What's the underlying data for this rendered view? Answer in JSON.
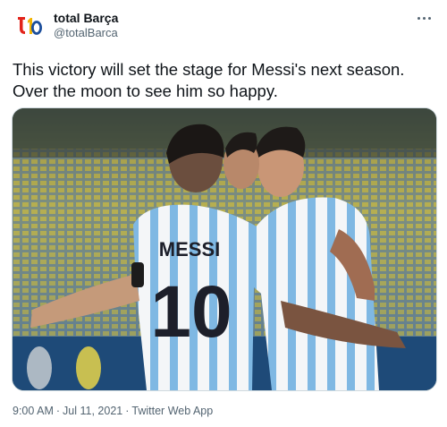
{
  "author": {
    "display_name": "total Barça",
    "handle": "@totalBarca",
    "avatar_icon": "total-barca-logo",
    "avatar_colors": {
      "red": "#e2231a",
      "yellow": "#f2b400",
      "blue": "#1d4f9c"
    }
  },
  "tweet": {
    "text": "This victory will set the stage for Messi's next season. Over the moon to see him so happy."
  },
  "media": {
    "jersey_name": "MESSI",
    "jersey_number": "10",
    "colors": {
      "stripe_blue": "#7fb8e3",
      "shirt_white": "#f4f6f8",
      "stands_yellow": "#d6c04a",
      "stands_blue": "#3f6e92"
    }
  },
  "meta": {
    "time": "9:00 AM",
    "separator": "·",
    "date": "Jul 11, 2021",
    "source": "Twitter Web App"
  },
  "icons": {
    "more": "more-dots-icon"
  }
}
